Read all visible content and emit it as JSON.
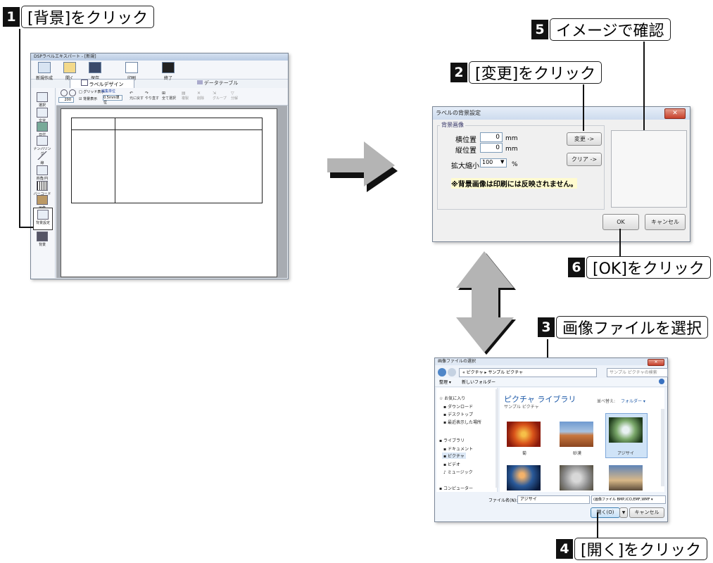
{
  "callouts": {
    "c1": {
      "num": "1",
      "text": "[背景]をクリック"
    },
    "c2": {
      "num": "2",
      "text": "[変更]をクリック"
    },
    "c3": {
      "num": "3",
      "text": "画像ファイルを選択"
    },
    "c4": {
      "num": "4",
      "text": "[開く]をクリック"
    },
    "c5": {
      "num": "5",
      "text": "イメージで確認"
    },
    "c6": {
      "num": "6",
      "text": "[OK]をクリック"
    }
  },
  "app": {
    "title": "DSPラベルエキスパート - [新規]",
    "toolbar": [
      "新規作成",
      "開く",
      "保存",
      "印刷",
      "終了"
    ],
    "tabs": {
      "design": "ラベルデザイン",
      "data": "データテーブル"
    },
    "grid_label": "グリッド表示",
    "bg_label": "背景表示",
    "unit_label": "編集単位",
    "unit_value": "0.5mm単位",
    "zoom_value": "200",
    "edit_tools": [
      "元に戻す",
      "やり直す",
      "全て選択",
      "複製",
      "削除",
      "グループ",
      "分解"
    ],
    "side_tools": [
      "選択",
      "文字",
      "日付",
      "ナンバリング",
      "線",
      "四角/円",
      "バーコード",
      "画像",
      "背景設定",
      "背景"
    ]
  },
  "bg_dialog": {
    "title": "ラベルの背景設定",
    "group_label": "背景画像",
    "horiz_label": "横位置",
    "vert_label": "縦位置",
    "horiz_value": "0",
    "vert_value": "0",
    "unit_mm": "mm",
    "scale_label": "拡大縮小",
    "scale_value": "100",
    "unit_pct": "%",
    "change_btn": "変更 ->",
    "clear_btn": "クリア ->",
    "note": "※背景画像は印刷には反映されません。",
    "ok_btn": "OK",
    "cancel_btn": "キャンセル"
  },
  "file_dialog": {
    "title": "画像ファイルの選択",
    "breadcrumb": "« ピクチャ ▸ サンプル ピクチャ",
    "search_placeholder": "サンプル ピクチャの検索",
    "organize": "整理 ▾",
    "new_folder": "新しいフォルダー",
    "nav_items": [
      "お気に入り",
      "ダウンロード",
      "デスクトップ",
      "最近表示した場所",
      "ライブラリ",
      "ドキュメント",
      "ピクチャ",
      "ビデオ",
      "ミュージック",
      "コンピューター"
    ],
    "library_title": "ピクチャ ライブラリ",
    "library_sub": "サンプル ピクチャ",
    "sort_label": "並べ替え:",
    "sort_value": "フォルダー ▾",
    "thumbs": [
      "菊",
      "砂漠",
      "アジサイ"
    ],
    "filename_label": "ファイル名(N):",
    "filename_value": "アジサイ",
    "filter_value": "(画像ファイル BMP,ICO,EMF,WMF ▾",
    "open_btn": "開く(O)",
    "cancel_btn": "キャンセル"
  }
}
